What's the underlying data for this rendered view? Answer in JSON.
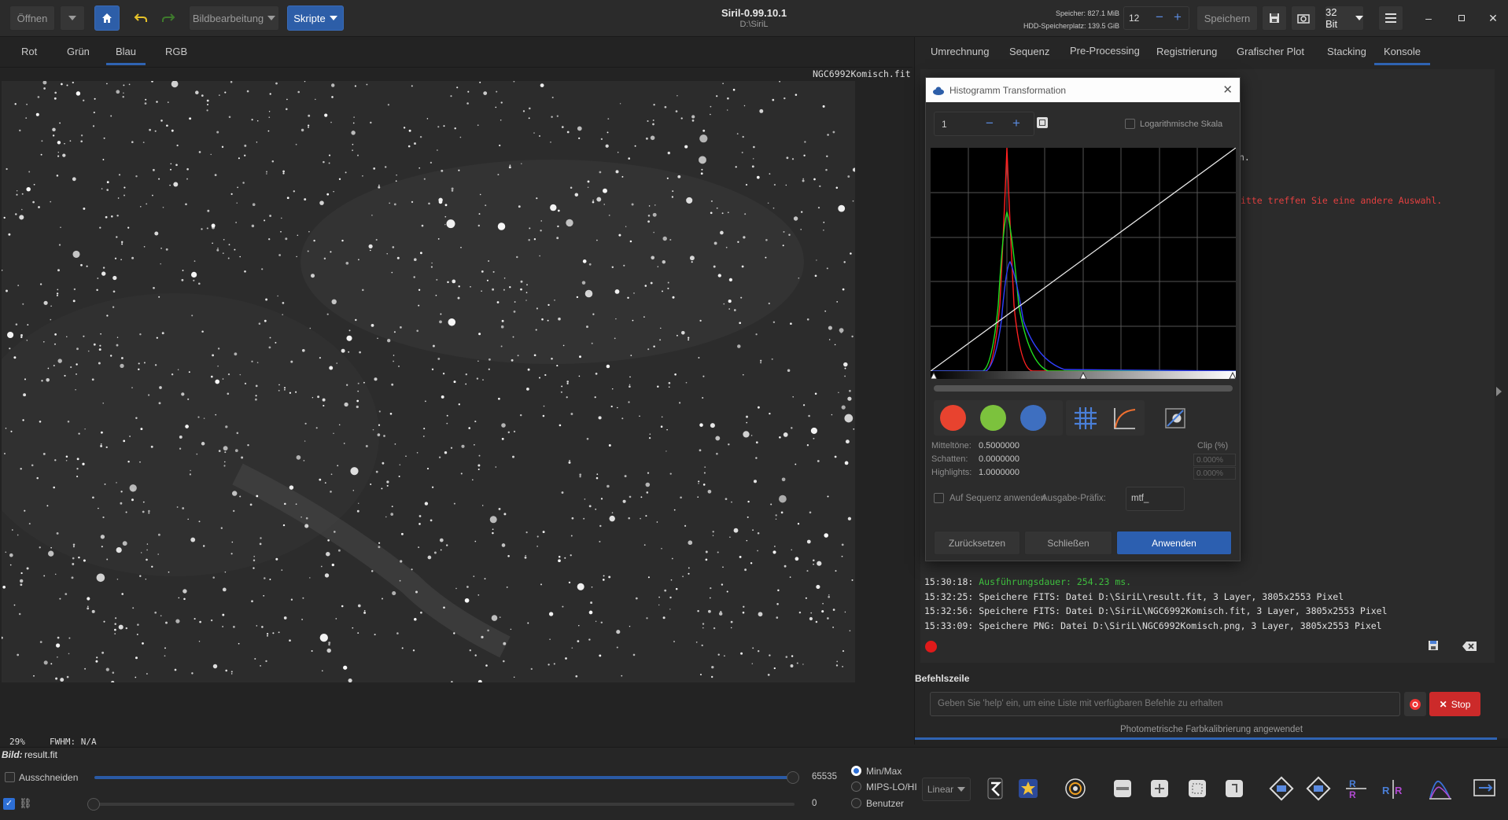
{
  "header": {
    "open_label": "Öffnen",
    "image_processing_label": "Bildbearbeitung",
    "scripts_label": "Skripte",
    "app_title": "Siril-0.99.10.1",
    "app_path": "D:\\SiriL",
    "memory_label": "Speicher: 827.1 MiB",
    "disk_label": "HDD-Speicherplatz: 139.5 GiB",
    "threads_value": "12",
    "save_label": "Speichern",
    "bitdepth_label": "32 Bit"
  },
  "channel_tabs": [
    "Rot",
    "Grün",
    "Blau",
    "RGB"
  ],
  "active_channel": "Blau",
  "image": {
    "filename": "NGC6992Komisch.fit",
    "zoom": "29%",
    "fwhm": "FWHM: N/A"
  },
  "right_tabs": [
    "Umrechnung",
    "Sequenz",
    "Pre-Processing",
    "Registrierung",
    "Grafischer Plot",
    "Stacking",
    "Konsole"
  ],
  "active_right_tab": "Konsole",
  "console": {
    "partial_line_1": "n.",
    "partial_line_2": "itte treffen Sie eine andere Auswahl.",
    "lines": [
      {
        "time": "15:30:18:",
        "text": "Ausführungsdauer: 254.23 ms.",
        "color": "#3fbf3f"
      },
      {
        "time": "15:32:25:",
        "text": "Speichere FITS: Datei D:\\SiriL\\result.fit, 3 Layer, 3805x2553 Pixel",
        "color": "#e0e0e0"
      },
      {
        "time": "15:32:56:",
        "text": "Speichere FITS: Datei D:\\SiriL\\NGC6992Komisch.fit, 3 Layer, 3805x2553 Pixel",
        "color": "#e0e0e0"
      },
      {
        "time": "15:33:09:",
        "text": "Speichere PNG: Datei D:\\SiriL\\NGC6992Komisch.png, 3 Layer, 3805x2553 Pixel",
        "color": "#e0e0e0"
      }
    ],
    "command_label": "Befehlszeile",
    "command_placeholder": "Geben Sie 'help' ein, um eine Liste mit verfügbaren Befehle zu erhalten",
    "stop_label": "Stop",
    "status_text": "Photometrische Farbkalibrierung angewendet"
  },
  "histogram_dialog": {
    "title": "Histogramm Transformation",
    "zoom_value": "1",
    "log_scale_label": "Logarithmische Skala",
    "midtones_label": "Mitteltöne:",
    "midtones_value": "0.5000000",
    "shadows_label": "Schatten:",
    "shadows_value": "0.0000000",
    "highlights_label": "Highlights:",
    "highlights_value": "1.0000000",
    "clip_label": "Clip (%)",
    "clip_low": "0.000%",
    "clip_high": "0.000%",
    "apply_sequence_label": "Auf Sequenz anwenden",
    "prefix_label": "Ausgabe-Präfix:",
    "prefix_value": "mtf_",
    "reset_label": "Zurücksetzen",
    "close_label": "Schließen",
    "apply_label": "Anwenden",
    "colors": {
      "red": "#e8432f",
      "green": "#7cc23d",
      "blue": "#3e6fc0"
    }
  },
  "bottom": {
    "image_label": "Bild:",
    "image_name": "result.fit",
    "crop_label": "Ausschneiden",
    "max_value": "65535",
    "min_value": "0",
    "range_options": [
      "Min/Max",
      "MIPS-LO/HI",
      "Benutzer"
    ],
    "selected_range": "Min/Max",
    "stretch_mode": "Linear"
  }
}
